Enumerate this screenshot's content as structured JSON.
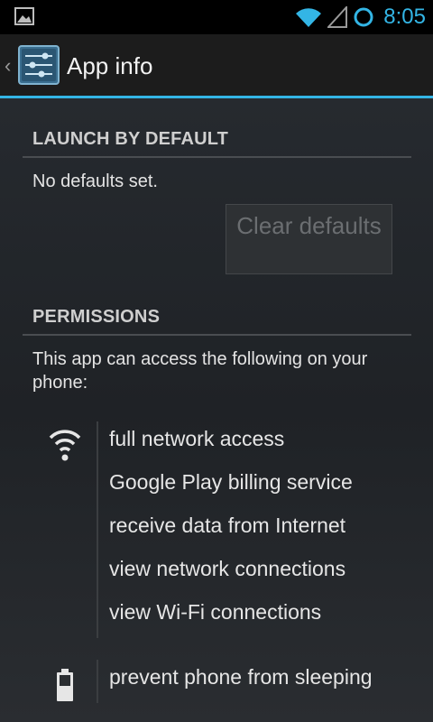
{
  "status_bar": {
    "time": "8:05",
    "icons": [
      "gallery-notification-icon",
      "wifi-icon",
      "signal-icon",
      "sync-circle-icon"
    ],
    "accent_color": "#33b5e5"
  },
  "action_bar": {
    "title": "App info",
    "app_icon": "settings-sliders-icon"
  },
  "launch_by_default": {
    "header": "LAUNCH BY DEFAULT",
    "text": "No defaults set.",
    "button_label": "Clear defaults"
  },
  "permissions": {
    "header": "PERMISSIONS",
    "intro": "This app can access the following on your phone:",
    "groups": [
      {
        "icon": "wifi-icon",
        "items": [
          "full network access",
          "Google Play billing service",
          "receive data from Internet",
          "view network connections",
          "view Wi-Fi connections"
        ]
      },
      {
        "icon": "battery-icon",
        "items": [
          "prevent phone from sleeping"
        ]
      }
    ]
  }
}
